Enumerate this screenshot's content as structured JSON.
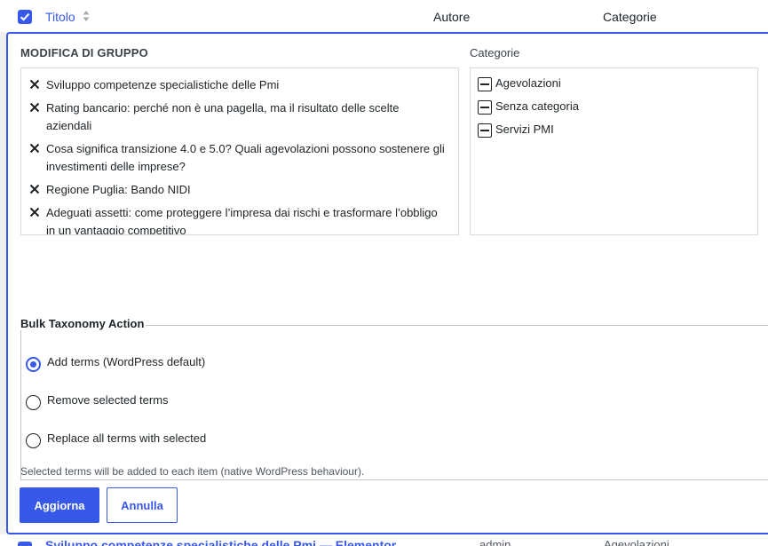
{
  "table_header": {
    "title": "Titolo",
    "author": "Autore",
    "categories": "Categorie"
  },
  "bulk_edit": {
    "heading": "MODIFICA DI GRUPPO",
    "posts": [
      {
        "title": "Sviluppo competenze specialistiche delle Pmi"
      },
      {
        "title": "Rating bancario: perché non è una pagella, ma il risultato delle scelte aziendali"
      },
      {
        "title": "Cosa significa transizione 4.0 e 5.0? Quali agevolazioni possono sostenere gli investimenti delle imprese?"
      },
      {
        "title": "Regione Puglia: Bando NIDI"
      },
      {
        "title": "Adeguati assetti: come proteggere l’impresa dai rischi e trasformare l’obbligo in un vantaggio competitivo"
      }
    ],
    "categories_label": "Categorie",
    "categories": [
      {
        "label": "Agevolazioni",
        "state": "indeterminate"
      },
      {
        "label": "Senza categoria",
        "state": "indeterminate"
      },
      {
        "label": "Servizi PMI",
        "state": "indeterminate"
      }
    ],
    "taxonomy": {
      "legend": "Bulk Taxonomy Action",
      "options": [
        {
          "label": "Add terms (WordPress default)",
          "selected": true
        },
        {
          "label": "Remove selected terms",
          "selected": false
        },
        {
          "label": "Replace all terms with selected",
          "selected": false
        }
      ],
      "help": "Selected terms will be added to each item (native WordPress behaviour)."
    },
    "update_label": "Aggiorna",
    "cancel_label": "Annulla"
  },
  "next_row": {
    "title": "Sviluppo competenze specialistiche delle Pmi — Elementor",
    "author": "admin",
    "categories": "Agevolazioni"
  },
  "colors": {
    "accent": "#3858e9",
    "text": "#1d2327",
    "border": "#dcdcde"
  }
}
